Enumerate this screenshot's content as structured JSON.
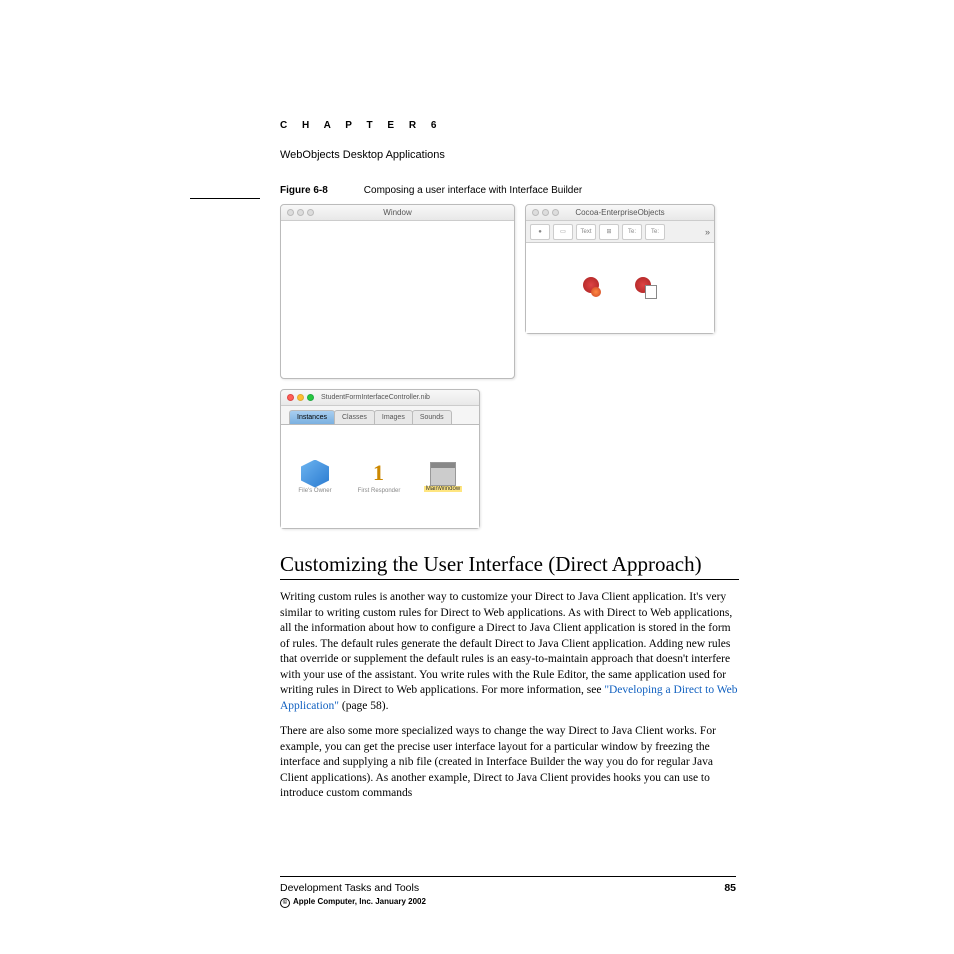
{
  "chapter": {
    "label": "C H A P T E R   6",
    "title": "WebObjects Desktop Applications"
  },
  "figure": {
    "label": "Figure 6-8",
    "caption": "Composing a user interface with Interface Builder"
  },
  "windows": {
    "design": {
      "title": "Window"
    },
    "palette": {
      "title": "Cocoa-EnterpriseObjects",
      "toolbar": [
        "●",
        "▭",
        "Text",
        "⊞",
        "Te:",
        "Te:",
        "»"
      ]
    },
    "nib": {
      "title": "StudentFormInterfaceController.nib",
      "tabs": [
        "Instances",
        "Classes",
        "Images",
        "Sounds"
      ],
      "active_tab": 0,
      "items": [
        {
          "label": "File's Owner"
        },
        {
          "label": "First Responder"
        },
        {
          "label": "MainWindow",
          "selected": true
        }
      ]
    }
  },
  "section": {
    "heading": "Customizing the User Interface (Direct Approach)"
  },
  "paragraphs": {
    "p1a": "Writing custom rules is another way to customize your Direct to Java Client application. It's very similar to writing custom rules for Direct to Web applications. As with Direct to Web applications, all the information about how to configure a Direct to Java Client application is stored in the form of rules. The default rules generate the default Direct to Java Client application. Adding new rules that override or supplement the default rules is an easy-to-maintain approach that doesn't interfere with your use of the assistant. You write rules with the Rule Editor, the same application used for writing rules in Direct to Web applications. For more information, see ",
    "p1link": "\"Developing a Direct to Web Application\"",
    "p1b": " (page 58).",
    "p2": "There are also some more specialized ways to change the way Direct to Java Client works. For example, you can get the precise user interface layout for a particular window by freezing the interface and supplying a nib file (created in Interface Builder the way you do for regular Java Client applications). As another example, Direct to Java Client provides hooks you can use to introduce custom commands"
  },
  "footer": {
    "section": "Development Tasks and Tools",
    "page": "85",
    "copyright": "Apple Computer, Inc. January 2002"
  }
}
